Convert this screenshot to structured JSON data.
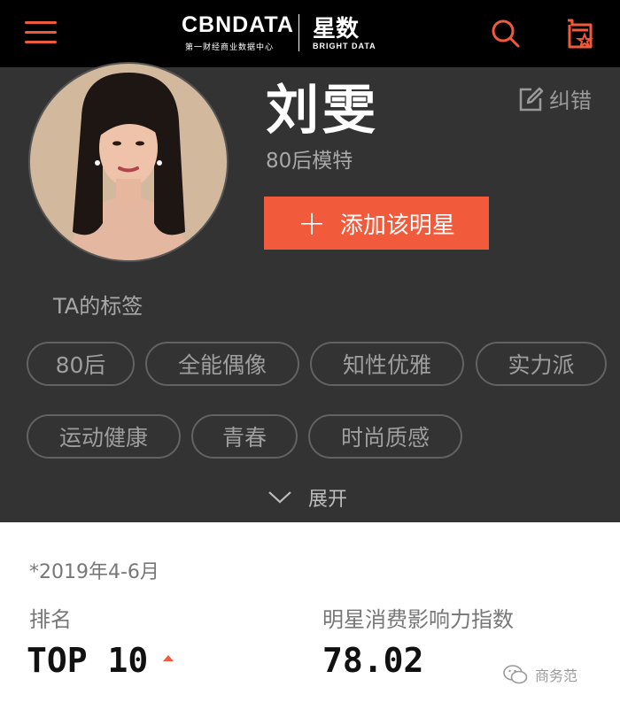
{
  "header": {
    "brand_main": "CBNDATA",
    "brand_sub": "第一财经商业数据中心",
    "brand_cn": "星数",
    "brand_en": "BRIGHT DATA",
    "accent_color": "#f05a3c",
    "menu_icon": "hamburger-menu-icon",
    "search_icon": "search-icon",
    "cart_icon": "star-cart-icon"
  },
  "profile": {
    "name": "刘雯",
    "subtitle": "80后模特",
    "edit_label": "纠错",
    "add_button_label": "添加该明星",
    "tags_title": "TA的标签",
    "tags": [
      "80后",
      "全能偶像",
      "知性优雅",
      "实力派",
      "运动健康",
      "青春",
      "时尚质感"
    ],
    "expand_label": "展开"
  },
  "stats": {
    "period": "*2019年4-6月",
    "rank_label": "排名",
    "rank_value": "TOP 10",
    "index_label": "明星消费影响力指数",
    "index_value": "78.02"
  },
  "watermark": {
    "text": "商务范"
  }
}
